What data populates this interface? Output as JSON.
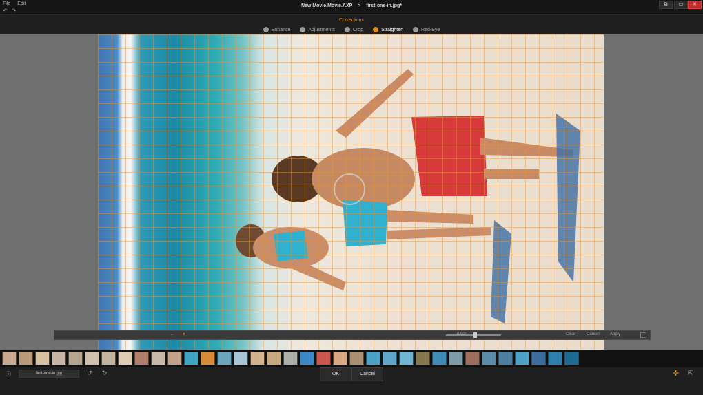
{
  "menu": [
    "File",
    "Edit"
  ],
  "quick_actions": [
    "↶",
    "↷"
  ],
  "doc_title": {
    "project": "New Movie.Movie.AXP",
    "separator": ">",
    "file": "first-one-in.jpg*"
  },
  "window_buttons": [
    "⧉",
    "▭",
    "✕"
  ],
  "corrections": {
    "title": "Corrections",
    "tools": [
      {
        "label": "Enhance"
      },
      {
        "label": "Adjustments"
      },
      {
        "label": "Crop"
      },
      {
        "label": "Straighten"
      },
      {
        "label": "Red-Eye"
      }
    ],
    "active_tool": "Straighten"
  },
  "straighten_bar": {
    "left_arrow": "←",
    "value": "0.00°",
    "clear": "Clear",
    "cancel": "Cancel",
    "apply": "Apply"
  },
  "filmstrip": {
    "thumbnails": [
      "#c9a98e",
      "#b79a7a",
      "#d7c1a0",
      "#c6b5a5",
      "#b5a690",
      "#d0c0ae",
      "#c2b39f",
      "#dfcdb5",
      "#b07f6c",
      "#c8b8a8",
      "#c2a289",
      "#3fa3c6",
      "#d88b3b",
      "#6aa7bd",
      "#a8c7d6",
      "#d3b38b",
      "#c8a880",
      "#aab0a7",
      "#3b88c8",
      "#c9574d",
      "#d8a680",
      "#a98f70",
      "#4aa0c5",
      "#5ea7c9",
      "#6fb4d0",
      "#85784f",
      "#3f8cb7",
      "#7c9aa9",
      "#9d6e5b",
      "#5b8ba7",
      "#4c7ea0",
      "#4f9fc9",
      "#3b6e9d",
      "#2f7fae",
      "#1f6a93"
    ]
  },
  "bottom": {
    "info": "ⓘ",
    "filename": "first-one-in.jpg",
    "rotate_left": "↺",
    "rotate_right": "↻",
    "ok": "OK",
    "cancel": "Cancel"
  },
  "colors": {
    "accent": "#e48b1c",
    "close": "#c62b2b"
  }
}
